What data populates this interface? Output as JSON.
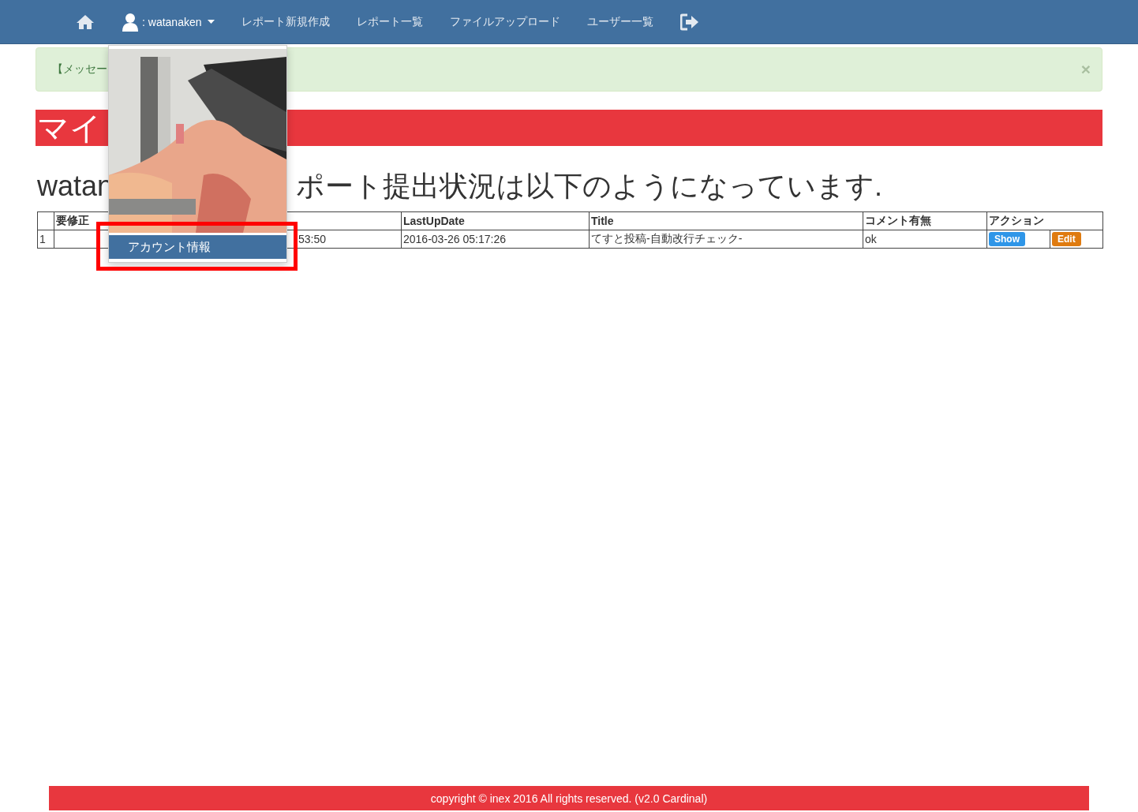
{
  "navbar": {
    "items": [
      {
        "kind": "home"
      },
      {
        "kind": "user",
        "label": ": watanaken",
        "expanded": true
      },
      {
        "kind": "link",
        "label": "レポート新規作成"
      },
      {
        "kind": "link",
        "label": "レポート一覧"
      },
      {
        "kind": "link",
        "label": "ファイルアップロード"
      },
      {
        "kind": "link",
        "label": "ユーザー一覧"
      },
      {
        "kind": "logout"
      }
    ]
  },
  "user_menu": {
    "items": [
      {
        "label": "アカウント情報",
        "selected": true
      }
    ],
    "highlighted": true
  },
  "alert": {
    "text": "【メッセー",
    "close": "×"
  },
  "banner": {
    "text": "マイ"
  },
  "heading": {
    "start": "watan",
    "end": "ポート提出状況は以下のようになっています."
  },
  "table": {
    "columns": [
      {
        "kind": "number"
      },
      {
        "kind": "text",
        "label": "要修正"
      },
      {
        "kind": "covered"
      },
      {
        "kind": "text",
        "label": "LastUpDate"
      },
      {
        "kind": "text",
        "label": "Title"
      },
      {
        "kind": "text",
        "label": "コメント有無"
      },
      {
        "kind": "actions",
        "label": "アクション"
      }
    ],
    "rows": [
      {
        "number": "1",
        "covered_tail": "53:50",
        "last_up_date": "2016-03-26 05:17:26",
        "title": "てすと投稿-自動改行チェック-",
        "comment": "ok",
        "actions": [
          {
            "kind": "show",
            "label": "Show"
          },
          {
            "kind": "edit",
            "label": "Edit"
          }
        ]
      }
    ]
  },
  "footer": {
    "text": "copyright © inex 2016 All rights reserved. (v2.0 Cardinal)"
  }
}
